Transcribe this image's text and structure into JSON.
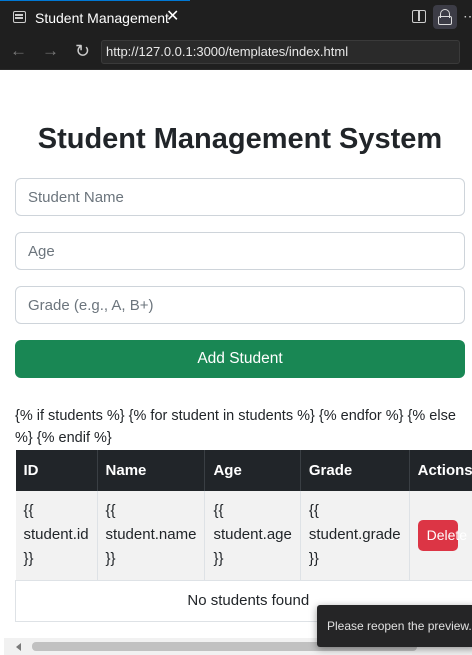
{
  "tab": {
    "title": "Student Management",
    "close": "✕"
  },
  "toolbar": {
    "more": "⋯"
  },
  "nav": {
    "back": "←",
    "forward": "→",
    "reload": "↻",
    "url": "http://127.0.0.1:3000/templates/index.html"
  },
  "page": {
    "title": "Student Management System",
    "inputs": {
      "name_placeholder": "Student Name",
      "age_placeholder": "Age",
      "grade_placeholder": "Grade (e.g., A, B+)"
    },
    "add_button": "Add Student",
    "template_text": "{% if students %} {% for student in students %} {% endfor %} {% else %} {% endif %}",
    "table": {
      "headers": [
        "ID",
        "Name",
        "Age",
        "Grade",
        "Actions"
      ],
      "row": [
        "{{ student.id }}",
        "{{ student.name }}",
        "{{ student.age }}",
        "{{ student.grade }}"
      ],
      "delete_label": "Delete",
      "empty_text": "No students found"
    }
  },
  "toast": "Please reopen the preview.",
  "colors": {
    "accent": "#198754",
    "danger": "#dc3545",
    "header": "#212529",
    "chrome": "#1f1f1f"
  }
}
